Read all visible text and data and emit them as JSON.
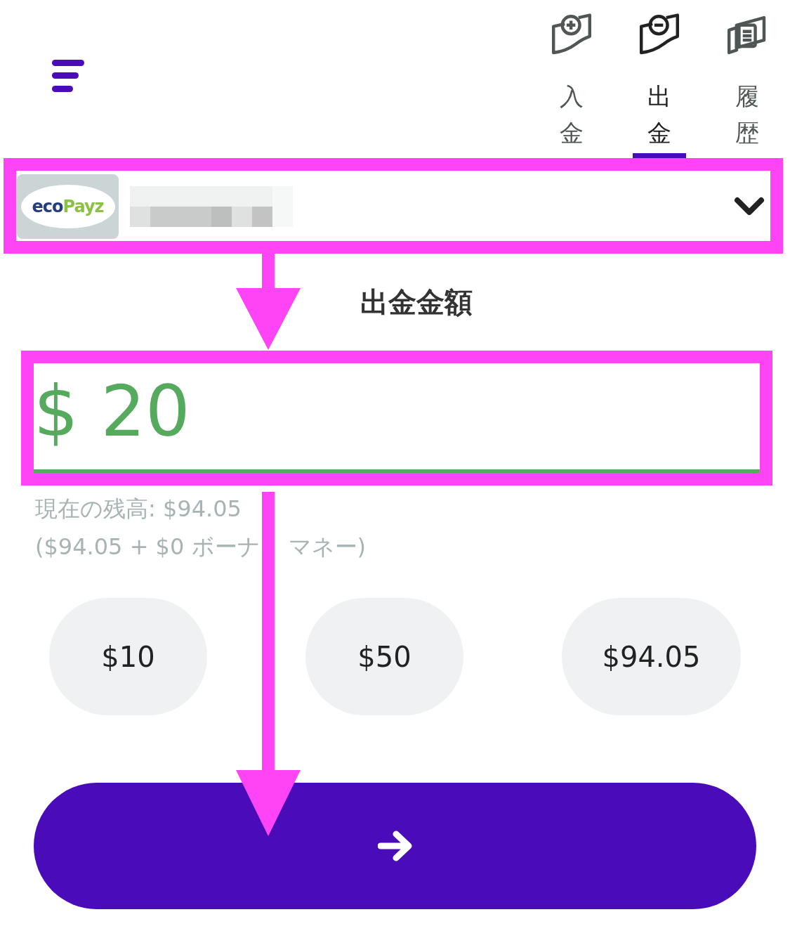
{
  "tabs": [
    {
      "label": "入金",
      "kind": "deposit",
      "selected": false
    },
    {
      "label": "出金",
      "kind": "withdraw",
      "selected": true
    },
    {
      "label": "履歴",
      "kind": "history",
      "selected": false
    }
  ],
  "method_selector": {
    "logo": {
      "left": "eco",
      "right": "Payz"
    },
    "highlighted": true
  },
  "amount_label": "出金金額",
  "amount_field": {
    "value": "$ 20",
    "highlighted": true
  },
  "balance": {
    "line_1": "現在の残高: $94.05",
    "line_2_before_arrow": "($94.05 + $0 ボーナ",
    "line_2_after_arrow": "マネー)"
  },
  "quick_amounts": [
    "$10",
    "$50",
    "$94.05"
  ]
}
